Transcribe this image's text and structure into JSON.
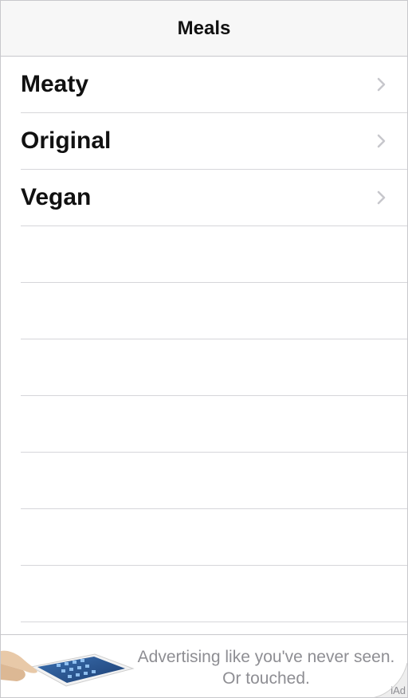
{
  "navbar": {
    "title": "Meals"
  },
  "table": {
    "rows": [
      {
        "label": "Meaty",
        "accessory": "chevron-right-icon"
      },
      {
        "label": "Original",
        "accessory": "chevron-right-icon"
      },
      {
        "label": "Vegan",
        "accessory": "chevron-right-icon"
      }
    ]
  },
  "ad_banner": {
    "line1": "Advertising like you've never seen.",
    "line2": "Or touched.",
    "badge": "iAd",
    "product_icon": "ipad-image"
  },
  "colors": {
    "navbar_background": "#f7f7f7",
    "separator": "#d6d6da",
    "chevron": "#c7c7cc",
    "ad_text": "#8e8e93"
  }
}
